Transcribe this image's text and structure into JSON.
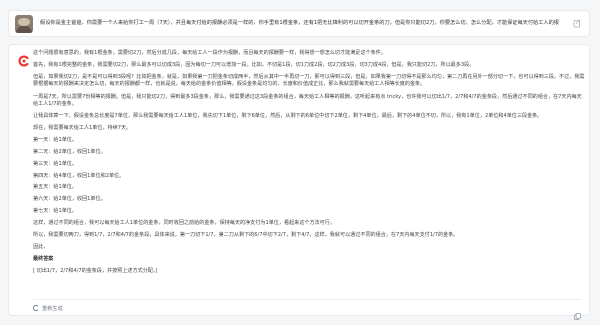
{
  "question": {
    "text": "假设你是金主爸爸，你需要一个人来给你打工一周（7天），并且每天付给的报酬必须是一样的，你手里有1根金条，还有1把无比锋利的可以切开金条的刀，但是你只能切2刀，你要怎么切、怎么分配，才能保证每天付给工人的报酬是一样的呢?"
  },
  "answer": {
    "paragraphs": [
      "这个问题很有意思的，我有1根金条，需要切2刀，然后分成几段，每天给工人一段作为报酬，而且每天的报酬要一样，我得想一想怎么切才能满足这个条件。",
      "首先，我有1根完整的金条，我需要切2刀，那么最多可以切成3段，因为每切一刀可以增加一段。比如，不切是1段，切1刀成2段，切2刀成3段，切3刀成4段，但是，我只能切2刀，所以最多3段。",
      "但是，如果我切2刀，是不是可以得到3段呢？比如把金条，就是，如果我第一刀把金条切成两半，然后从其中一半再切一刀，那可以得到三段，但是，如果我第一刀切得不是那么均匀，第二刀再在另外一部分切一下，也可以得到三段。不过，我需要根据每天的报酬来决定怎么切，每天的报酬都一样，也就是说，每天给的金条价值相等，假设金条是均匀的，长度和价值成正比，那么我就需要每天给工人相等长度的金条。",
      "一周是7天，所以需要7份相等的报酬。但是，我只能切2刀，得到最多3段金条，那么，我需要通过这3段金条的组合，每天给工人相等的报酬，这听起来有点 tricky，也许我可以切出1/7，2/7和4/7的金条段，然后通过不同的组合，在7天内每天给工人1/7的金条。",
      "让我具体算一下，假设金条总长度是7单位，那么我需要每天给工人1单位，我先切下1单位，剩下6单位，然后，从剩下的6单位中切下2单位，剩下4单位，最后，剩下的4单位不切，所以，我有1单位，2单位和4单位三段金条。",
      "现在，我需要每天给工人1单位，持续7天。",
      "第一天：给1单位。",
      "第二天：给2单位，收回1单位。",
      "第三天：给1单位。",
      "第四天：给4单位，收回1单位和2单位。",
      "第五天：给1单位。",
      "第六天：给2单位，收回1单位。",
      "第七天：给1单位。",
      "这样，通过不同的组合，我可以每天给工人1单位的金条，同时收回之前给的金条，保持每天的净支付为1单位，看起来这个方法可行。",
      "所以，我需要切两刀，得到1/7，2/7和4/7的金条段，具体来说，第一刀切下1/7，第二刀从剩下的6/7中切下2/7，剩下4/7，这样，我就可以通过不同的组合，在7天内每天支付1/7的金条。",
      "因此，",
      "最终答案",
      "[ 切出1/7，2/7和4/7的金条段，并按照上述方式分配。]"
    ],
    "regenerate_label": "重新生成"
  },
  "colors": {
    "page_bg": "#f5f6f8",
    "card_bg": "#ffffff",
    "brand_red": "#e8352b"
  },
  "icons": {
    "question_action": "edit-icon",
    "answer_logo": "brand-logo-icon",
    "regenerate": "refresh-icon",
    "copy": "copy-icon"
  }
}
